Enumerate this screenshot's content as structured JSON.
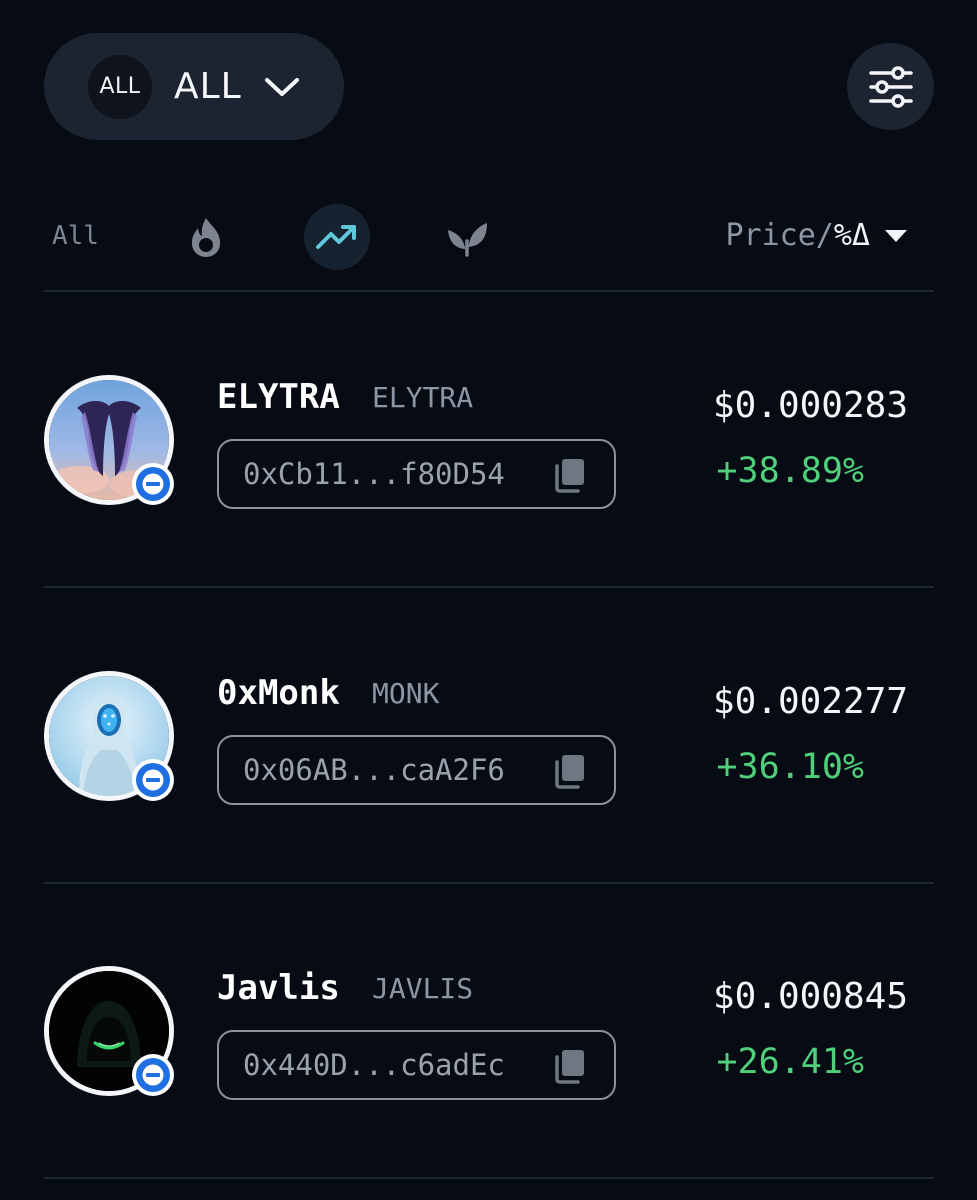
{
  "header": {
    "chain_badge": "ALL",
    "chain_label": "ALL",
    "chain_chevron_icon": "chevron-down-icon",
    "filter_icon": "sliders-icon"
  },
  "tabs": {
    "all_label": "All",
    "items": [
      {
        "icon": "flame-icon",
        "selected": false
      },
      {
        "icon": "trending-up-icon",
        "selected": true
      },
      {
        "icon": "sprout-icon",
        "selected": false
      }
    ],
    "sort_label_price": "Price/",
    "sort_label_change": "%Δ",
    "sort_icon": "caret-down-icon"
  },
  "colors": {
    "background": "#070b14",
    "surface": "#1c2431",
    "positive": "#4fd07a",
    "accent": "#5cc8d8",
    "chain_blue": "#1f6fe0"
  },
  "tokens": [
    {
      "name": "ELYTRA",
      "symbol": "ELYTRA",
      "address": "0xCb11...f80D54",
      "price": "$0.000283",
      "change": "+38.89%"
    },
    {
      "name": "0xMonk",
      "symbol": "MONK",
      "address": "0x06AB...caA2F6",
      "price": "$0.002277",
      "change": "+36.10%"
    },
    {
      "name": "Javlis",
      "symbol": "JAVLIS",
      "address": "0x440D...c6adEc",
      "price": "$0.000845",
      "change": "+26.41%"
    }
  ]
}
